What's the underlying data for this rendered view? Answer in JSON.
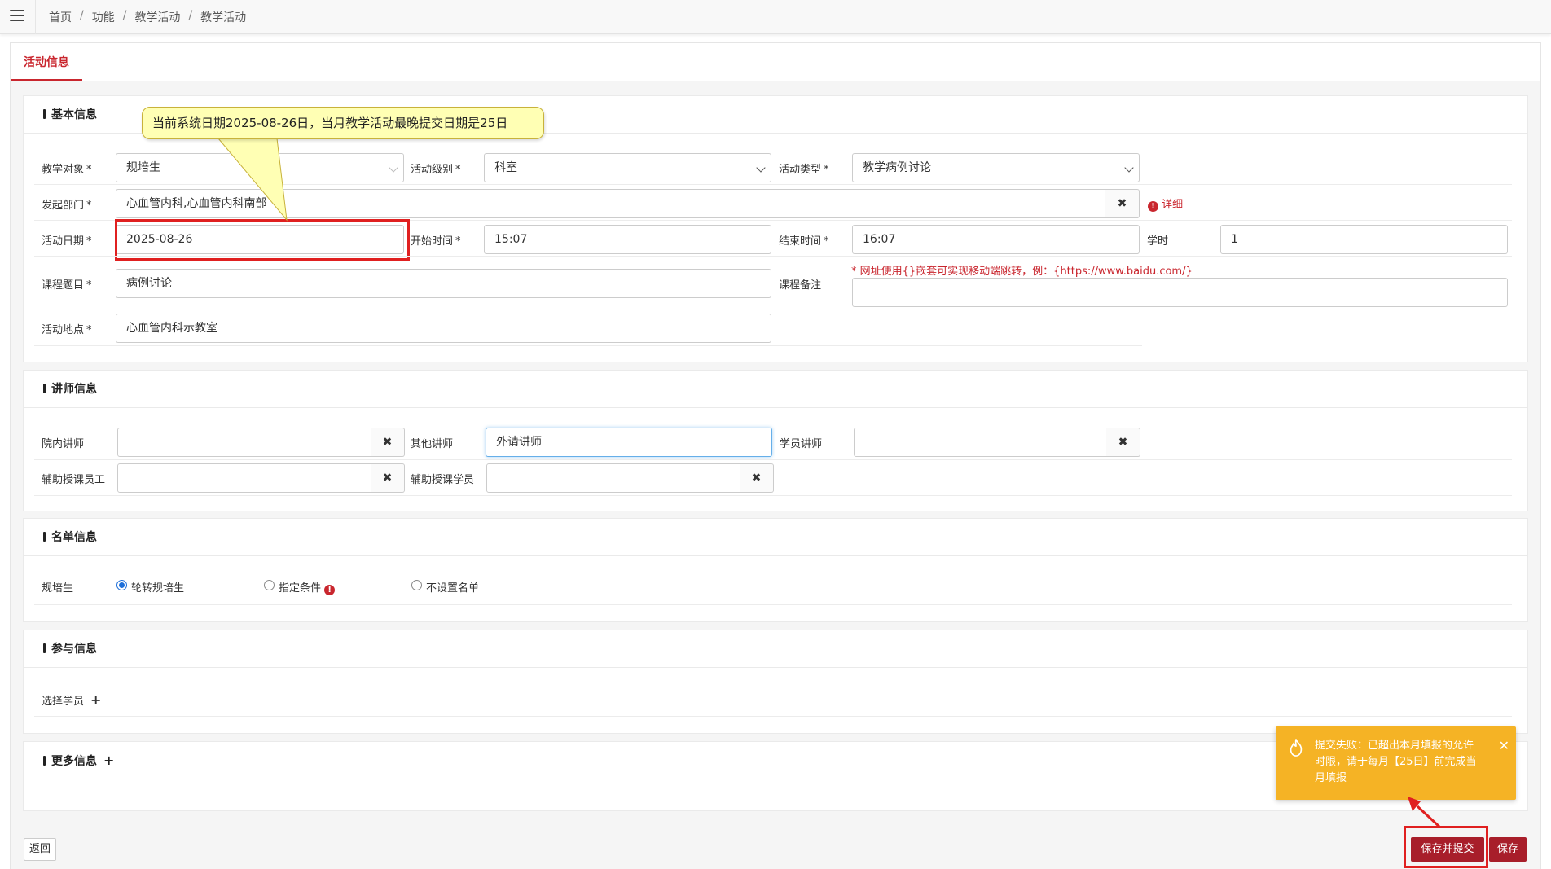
{
  "breadcrumb": {
    "items": [
      "首页",
      "功能",
      "教学活动",
      "教学活动"
    ],
    "sep": "/"
  },
  "tab": {
    "label": "活动信息"
  },
  "annotation": {
    "text": "当前系统日期2025-08-26日，当月教学活动最晚提交日期是25日"
  },
  "basic": {
    "header": "基本信息",
    "target_label": "教学对象",
    "target_value": "规培生",
    "level_label": "活动级别",
    "level_value": "科室",
    "type_label": "活动类型",
    "type_value": "教学病例讨论",
    "dept_label": "发起部门",
    "dept_value": "心血管内科,心血管内科南部",
    "detail_label": "详细",
    "date_label": "活动日期",
    "date_value": "2025-08-26",
    "start_label": "开始时间",
    "start_value": "15:07",
    "end_label": "结束时间",
    "end_value": "16:07",
    "hours_label": "学时",
    "hours_value": "1",
    "topic_label": "课程题目",
    "topic_value": "病例讨论",
    "remark_label": "课程备注",
    "remark_note": "* 网址使用{}嵌套可实现移动端跳转，例：{https://www.baidu.com/}",
    "place_label": "活动地点",
    "place_value": "心血管内科示教室",
    "required_mark": "*"
  },
  "lecturer": {
    "header": "讲师信息",
    "inner_label": "院内讲师",
    "inner_value": "",
    "other_label": "其他讲师",
    "other_value": "外请讲师",
    "student_label": "学员讲师",
    "student_value": "",
    "assist_staff_label": "辅助授课员工",
    "assist_staff_value": "",
    "assist_student_label": "辅助授课学员",
    "assist_student_value": ""
  },
  "roster": {
    "header": "名单信息",
    "label": "规培生",
    "options": [
      "轮转规培生",
      "指定条件",
      "不设置名单"
    ],
    "selected": "轮转规培生"
  },
  "participate": {
    "header": "参与信息",
    "select_label": "选择学员"
  },
  "more": {
    "header": "更多信息"
  },
  "buttons": {
    "back": "返回",
    "save_submit": "保存并提交",
    "save": "保存"
  },
  "toast": {
    "message": "提交失败：已超出本月填报的允许时限，请于每月【25日】前完成当月填报"
  },
  "colors": {
    "accent": "#c9262e",
    "button": "#a81e2a",
    "toast": "#f5b325",
    "highlight": "#e02020"
  }
}
